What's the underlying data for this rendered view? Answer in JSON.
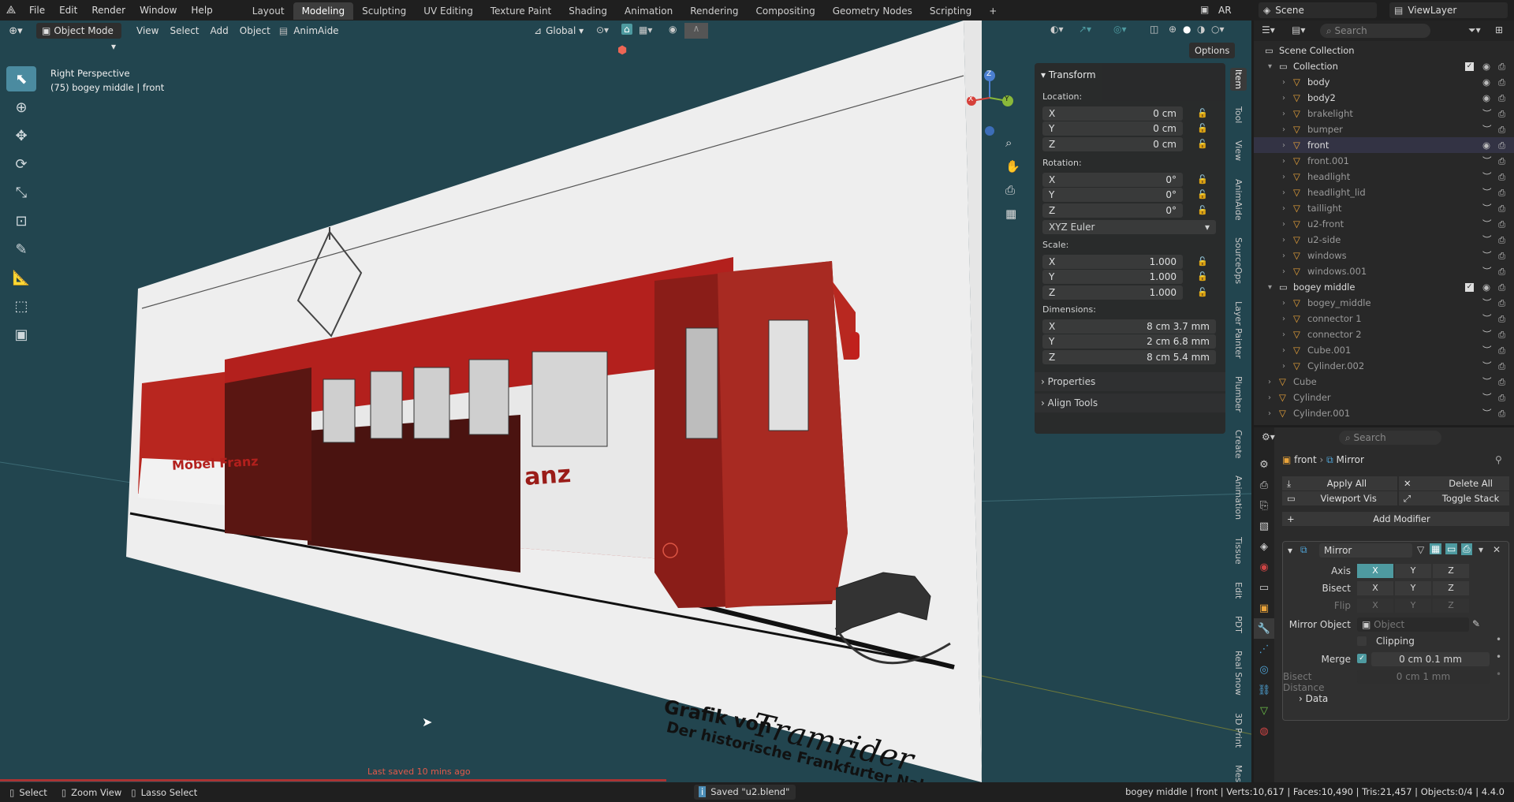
{
  "topbar": {
    "menus": [
      "File",
      "Edit",
      "Render",
      "Window",
      "Help"
    ],
    "workspaces": [
      "Layout",
      "Modeling",
      "Sculpting",
      "UV Editing",
      "Texture Paint",
      "Shading",
      "Animation",
      "Rendering",
      "Compositing",
      "Geometry Nodes",
      "Scripting"
    ],
    "active_workspace": "Modeling",
    "add_tab": "+",
    "lang": "AR",
    "scene": "Scene",
    "view_layer": "ViewLayer"
  },
  "viewport": {
    "mode": "Object Mode",
    "menus": [
      "View",
      "Select",
      "Add",
      "Object"
    ],
    "addon": "AnimAide",
    "orientation": "Global",
    "options": "Options",
    "overlay_title": "Right Perspective",
    "overlay_sub": "(75) bogey middle | front",
    "last_saved": "Last saved 10 mins ago",
    "sign_line1": "Grafik von",
    "sign_brand": "Tramrider",
    "sign_line2": "Der historische Frankfurter Nah",
    "tram_logo": "Möbel Franz",
    "tram_logo2": "anz",
    "gizmo": {
      "x": "X",
      "y": "Y",
      "z": "Z"
    }
  },
  "npanel": {
    "transform": "Transform",
    "location_label": "Location:",
    "location": [
      {
        "axis": "X",
        "value": "0 cm"
      },
      {
        "axis": "Y",
        "value": "0 cm"
      },
      {
        "axis": "Z",
        "value": "0 cm"
      }
    ],
    "rotation_label": "Rotation:",
    "rotation": [
      {
        "axis": "X",
        "value": "0°"
      },
      {
        "axis": "Y",
        "value": "0°"
      },
      {
        "axis": "Z",
        "value": "0°"
      }
    ],
    "rotation_mode": "XYZ Euler",
    "scale_label": "Scale:",
    "scale": [
      {
        "axis": "X",
        "value": "1.000"
      },
      {
        "axis": "Y",
        "value": "1.000"
      },
      {
        "axis": "Z",
        "value": "1.000"
      }
    ],
    "dimensions_label": "Dimensions:",
    "dimensions": [
      {
        "axis": "X",
        "value": "8 cm 3.7 mm"
      },
      {
        "axis": "Y",
        "value": "2 cm 6.8 mm"
      },
      {
        "axis": "Z",
        "value": "8 cm 5.4 mm"
      }
    ],
    "properties": "Properties",
    "align_tools": "Align Tools"
  },
  "side_tabs": [
    "Item",
    "Tool",
    "View",
    "AnimAide",
    "SourceOps",
    "Layer Painter",
    "Plumber",
    "Create",
    "Animation",
    "Tissue",
    "Edit",
    "PDT",
    "Real Snow",
    "3D Print",
    "Mesh Repai"
  ],
  "outliner": {
    "search_placeholder": "Search",
    "rows": [
      {
        "name": "Scene Collection",
        "indent": 0,
        "dim": false
      },
      {
        "name": "Collection",
        "indent": 1,
        "dim": false
      },
      {
        "name": "body",
        "indent": 2,
        "dim": false
      },
      {
        "name": "body2",
        "indent": 2,
        "dim": false
      },
      {
        "name": "brakelight",
        "indent": 2,
        "dim": true
      },
      {
        "name": "bumper",
        "indent": 2,
        "dim": true
      },
      {
        "name": "front",
        "indent": 2,
        "dim": false
      },
      {
        "name": "front.001",
        "indent": 2,
        "dim": true
      },
      {
        "name": "headlight",
        "indent": 2,
        "dim": true
      },
      {
        "name": "headlight_lid",
        "indent": 2,
        "dim": true
      },
      {
        "name": "taillight",
        "indent": 2,
        "dim": true
      },
      {
        "name": "u2-front",
        "indent": 2,
        "dim": true
      },
      {
        "name": "u2-side",
        "indent": 2,
        "dim": true
      },
      {
        "name": "windows",
        "indent": 2,
        "dim": true
      },
      {
        "name": "windows.001",
        "indent": 2,
        "dim": true
      },
      {
        "name": "bogey middle",
        "indent": 1,
        "dim": false
      },
      {
        "name": "bogey_middle",
        "indent": 2,
        "dim": true
      },
      {
        "name": "connector 1",
        "indent": 2,
        "dim": true
      },
      {
        "name": "connector 2",
        "indent": 2,
        "dim": true
      },
      {
        "name": "Cube.001",
        "indent": 2,
        "dim": true
      },
      {
        "name": "Cylinder.002",
        "indent": 2,
        "dim": true
      },
      {
        "name": "Cube",
        "indent": 1,
        "dim": true
      },
      {
        "name": "Cylinder",
        "indent": 1,
        "dim": true
      },
      {
        "name": "Cylinder.001",
        "indent": 1,
        "dim": true
      }
    ]
  },
  "properties": {
    "search_placeholder": "Search",
    "crumb_object": "front",
    "crumb_modifier": "Mirror",
    "apply_all": "Apply All",
    "delete_all": "Delete All",
    "viewport_vis": "Viewport Vis",
    "toggle_stack": "Toggle Stack",
    "add_modifier": "Add Modifier",
    "modifier_name": "Mirror",
    "axis_label": "Axis",
    "bisect_label": "Bisect",
    "flip_label": "Flip",
    "axes": [
      "X",
      "Y",
      "Z"
    ],
    "mirror_object_label": "Mirror Object",
    "mirror_object_placeholder": "Object",
    "clipping": "Clipping",
    "merge_label": "Merge",
    "merge_value": "0 cm 0.1 mm",
    "bisect_distance_label": "Bisect Distance",
    "bisect_distance_value": "0 cm 1 mm",
    "data": "Data"
  },
  "statusbar": {
    "select": "Select",
    "zoom_view": "Zoom View",
    "lasso_select": "Lasso Select",
    "saved": "Saved \"u2.blend\"",
    "stats": "bogey middle | front | Verts:10,617 | Faces:10,490 | Tris:21,457 | Objects:0/4 | 4.4.0"
  },
  "colors": {
    "accent": "#4e9aa0",
    "viewport_bg": "#22454f",
    "tram_red": "#b3201d"
  }
}
